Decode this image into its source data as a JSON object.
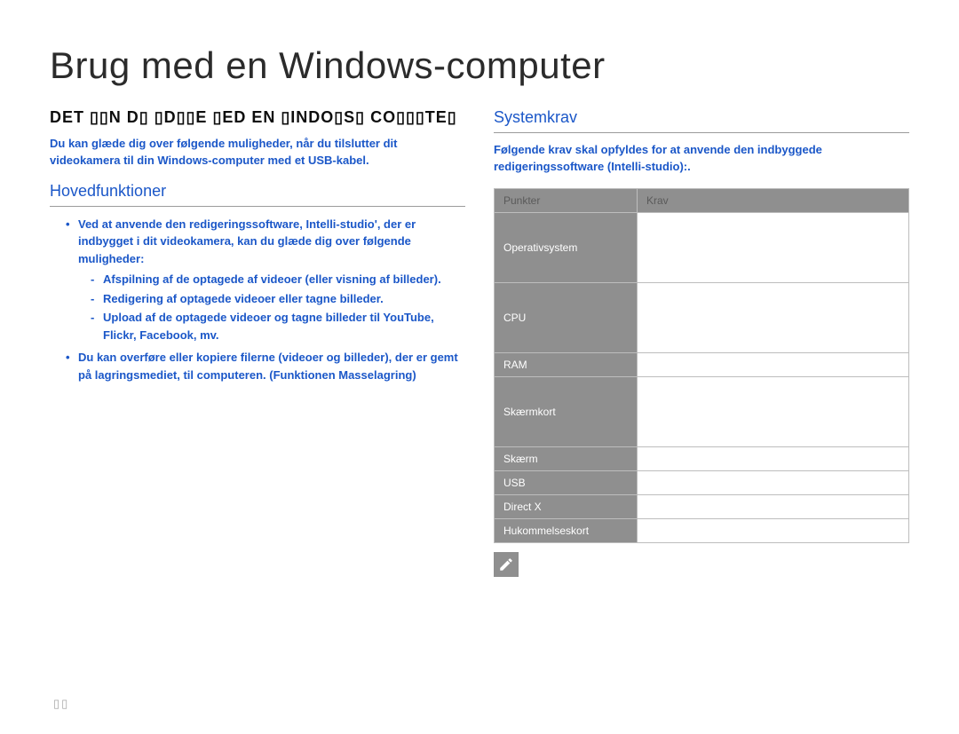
{
  "title": "Brug med en Windows-computer",
  "left": {
    "section_label": "DET ▯▯N D▯ ▯D▯▯E ▯ED EN ▯INDO▯S▯ CO▯▯▯TE▯",
    "intro": "Du kan glæde dig over følgende muligheder, når du tilslutter dit videokamera til din Windows-computer med et USB-kabel.",
    "subheading": "Hovedfunktioner",
    "bullet1_lead": "Ved at anvende den redigeringssoftware,  Intelli-studio', der er indbygget i dit videokamera, kan du glæde dig over følgende muligheder:",
    "sub": [
      "Afspilning af de optagede af videoer (eller visning af billeder).",
      "Redigering af optagede videoer eller tagne billeder.",
      "Upload af de optagede videoer og tagne billeder til YouTube, Flickr, Facebook, mv."
    ],
    "bullet2": "Du kan overføre eller kopiere filerne (videoer og billeder), der er gemt på lagringsmediet, til computeren. (Funktionen Masselagring)"
  },
  "right": {
    "subheading": "Systemkrav",
    "intro": "Følgende krav skal opfyldes for at anvende den indbyggede redigeringssoftware (Intelli-studio):.",
    "table": {
      "head_left": "Punkter",
      "head_right": "Krav",
      "rows": [
        {
          "label": "Operativsystem",
          "value": "",
          "tall": true
        },
        {
          "label": "CPU",
          "value": "",
          "tall": true
        },
        {
          "label": "RAM",
          "value": ""
        },
        {
          "label": "Skærmkort",
          "value": "",
          "tall": true
        },
        {
          "label": "Skærm",
          "value": ""
        },
        {
          "label": "USB",
          "value": ""
        },
        {
          "label": "Direct X",
          "value": ""
        },
        {
          "label": "Hukommelseskort",
          "value": ""
        }
      ]
    }
  },
  "page_number": "▯▯"
}
